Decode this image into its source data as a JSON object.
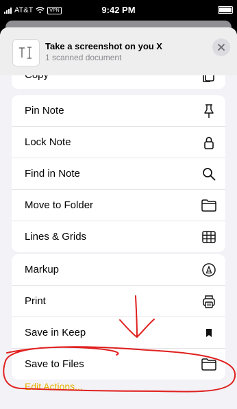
{
  "status": {
    "carrier": "AT&T",
    "vpn": "VPN",
    "time": "9:42 PM"
  },
  "header": {
    "title": "Take a screenshot on you X",
    "subtitle": "1 scanned document",
    "close_icon": "close-icon"
  },
  "partial_row": {
    "label": "Copy"
  },
  "group1": [
    {
      "label": "Pin Note",
      "icon": "pin-icon"
    },
    {
      "label": "Lock Note",
      "icon": "lock-icon"
    },
    {
      "label": "Find in Note",
      "icon": "search-icon"
    },
    {
      "label": "Move to Folder",
      "icon": "folder-icon"
    },
    {
      "label": "Lines & Grids",
      "icon": "grid-icon"
    }
  ],
  "group2": [
    {
      "label": "Markup",
      "icon": "markup-icon"
    },
    {
      "label": "Print",
      "icon": "print-icon"
    },
    {
      "label": "Save in Keep",
      "icon": "bookmark-icon"
    },
    {
      "label": "Save to Files",
      "icon": "folder-icon"
    }
  ],
  "edit_actions": "Edit Actions...",
  "colors": {
    "annotation": "#e0201e",
    "accent": "#e8b100"
  }
}
